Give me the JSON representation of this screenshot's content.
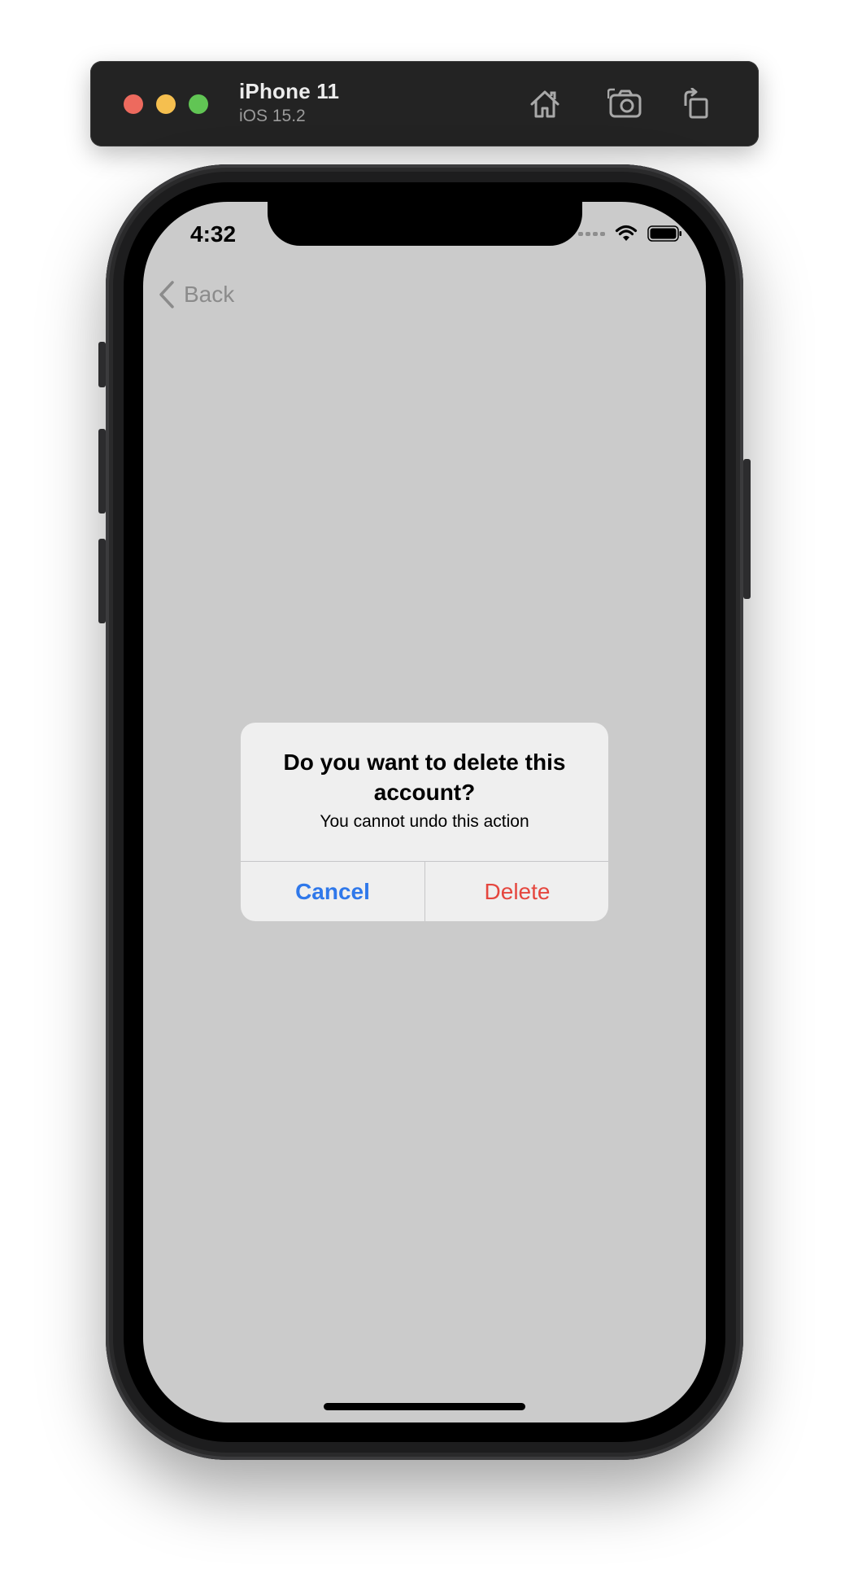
{
  "simulator": {
    "device_name": "iPhone 11",
    "os_version": "iOS 15.2",
    "icons": [
      "close-window-icon",
      "minimize-window-icon",
      "zoom-window-icon",
      "home-icon",
      "screenshot-icon",
      "rotate-icon"
    ]
  },
  "status_bar": {
    "time": "4:32",
    "icons": [
      "cellular-signal-icon",
      "wifi-icon",
      "battery-icon"
    ]
  },
  "nav": {
    "back_label": "Back",
    "back_icon": "chevron-left-icon"
  },
  "alert": {
    "title": "Do you want to delete this account?",
    "message": "You cannot undo this action",
    "cancel_label": "Cancel",
    "delete_label": "Delete"
  },
  "colors": {
    "screen_background": "#cbcbcb",
    "alert_background": "#efefef",
    "cancel_blue": "#2f78ea",
    "delete_red": "#e5463e",
    "traffic_red": "#ed6a5e",
    "traffic_yellow": "#f5bf4f",
    "traffic_green": "#61c554"
  }
}
